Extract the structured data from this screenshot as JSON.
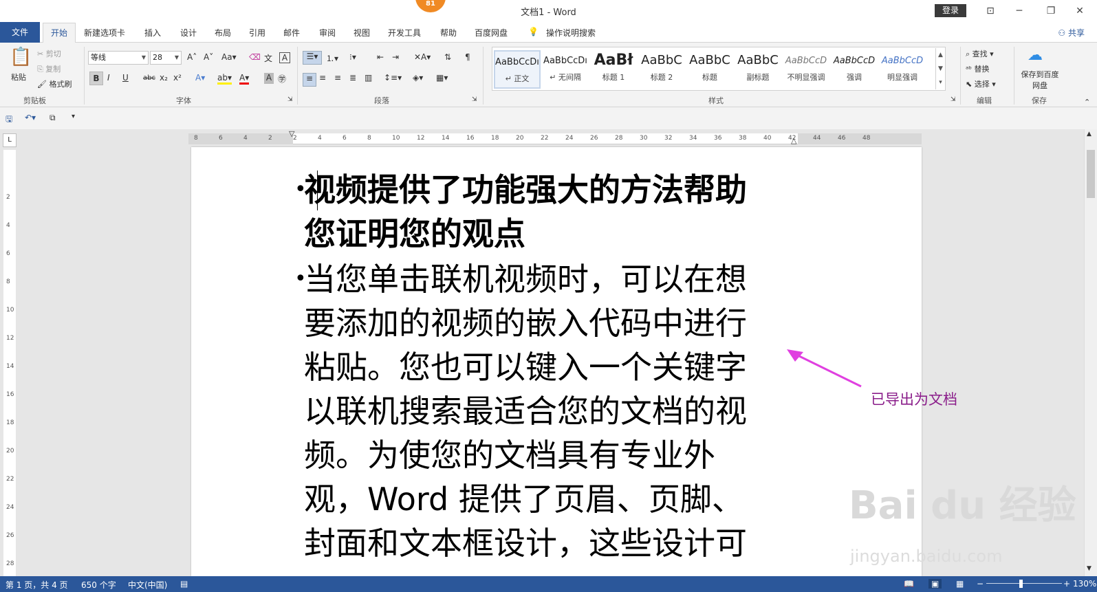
{
  "window": {
    "title": "文档1  -  Word",
    "badge": "81",
    "login": "登录"
  },
  "tabs": {
    "file": "文件",
    "active": "开始",
    "items": [
      "新建选项卡",
      "插入",
      "设计",
      "布局",
      "引用",
      "邮件",
      "审阅",
      "视图",
      "开发工具",
      "帮助",
      "百度网盘"
    ],
    "tell_me": "操作说明搜索",
    "share": "共享"
  },
  "ribbon": {
    "clipboard": {
      "paste": "粘贴",
      "cut": "剪切",
      "copy": "复制",
      "format_painter": "格式刷",
      "label": "剪贴板"
    },
    "font": {
      "name": "等线",
      "size": "28",
      "label": "字体",
      "bold": "B",
      "italic": "I",
      "underline": "U",
      "strike": "abc",
      "sub": "x₂",
      "sup": "x²"
    },
    "paragraph": {
      "label": "段落"
    },
    "styles": {
      "label": "样式",
      "items": [
        {
          "preview": "AaBbCcDı",
          "name": "↵ 正文"
        },
        {
          "preview": "AaBbCcDı",
          "name": "↵ 无间隔"
        },
        {
          "preview": "AaBł",
          "name": "标题 1"
        },
        {
          "preview": "AaBbC",
          "name": "标题 2"
        },
        {
          "preview": "AaBbC",
          "name": "标题"
        },
        {
          "preview": "AaBbC",
          "name": "副标题"
        },
        {
          "preview": "AaBbCcD",
          "name": "不明显强调"
        },
        {
          "preview": "AaBbCcD",
          "name": "强调"
        },
        {
          "preview": "AaBbCcD",
          "name": "明显强调"
        }
      ]
    },
    "editing": {
      "find": "查找",
      "replace": "替换",
      "select": "选择",
      "label": "编辑"
    },
    "save": {
      "button": "保存到百度网盘",
      "label": "保存"
    }
  },
  "ruler": {
    "h_ticks": [
      "8",
      "6",
      "4",
      "2",
      "2",
      "4",
      "6",
      "8",
      "10",
      "12",
      "14",
      "16",
      "18",
      "20",
      "22",
      "24",
      "26",
      "28",
      "30",
      "32",
      "34",
      "36",
      "38",
      "40",
      "42",
      "44",
      "46",
      "48"
    ],
    "v_ticks": [
      "2",
      "4",
      "6",
      "8",
      "10",
      "12",
      "14",
      "16",
      "18",
      "20",
      "22",
      "24",
      "26",
      "28"
    ]
  },
  "document": {
    "bullet1_lines": [
      "视频提供了功能强大的方法帮助",
      "您证明您的观点"
    ],
    "bullet2_lines": [
      "当您单击联机视频时，可以在想",
      "要添加的视频的嵌入代码中进行",
      "粘贴。您也可以键入一个关键字",
      "以联机搜索最适合您的文档的视",
      "频。为使您的文档具有专业外",
      "观，Word 提供了页眉、页脚、",
      "封面和文本框设计，这些设计可"
    ]
  },
  "annotation": {
    "text": "已导出为文档",
    "color": "#e040e0"
  },
  "watermark": {
    "main": "Bai du 经验",
    "sub": "jingyan.baidu.com"
  },
  "status": {
    "page": "第 1 页，共 4 页",
    "words": "650 个字",
    "language": "中文(中国)",
    "zoom": "130%"
  },
  "colors": {
    "accent": "#2b579a"
  }
}
